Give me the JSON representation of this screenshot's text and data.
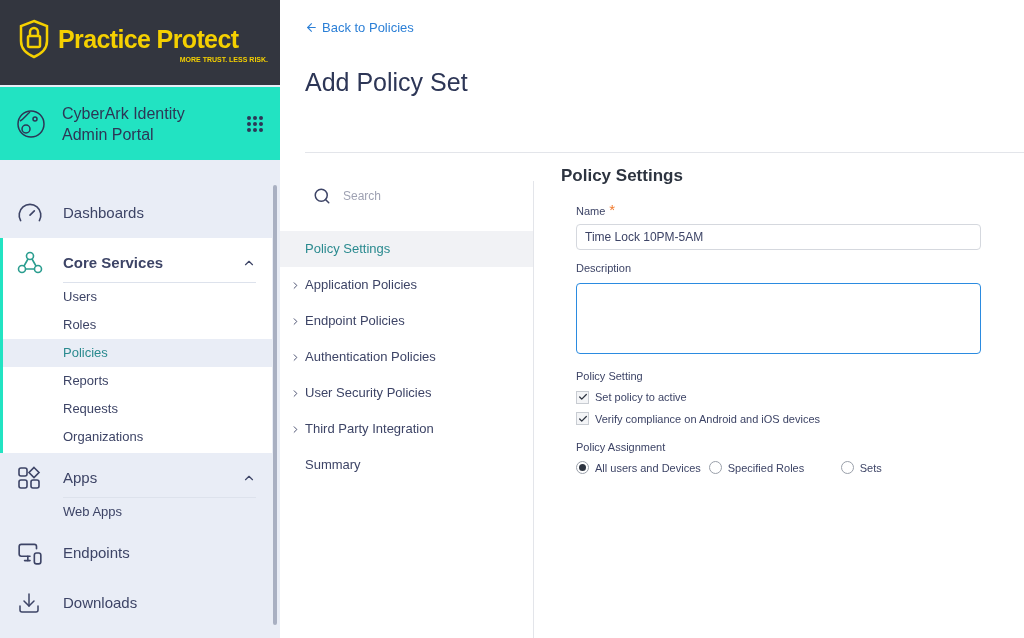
{
  "logo": {
    "name": "Practice Protect",
    "tagline": "MORE TRUST. LESS RISK."
  },
  "portal": {
    "title": "CyberArk Identity Admin Portal"
  },
  "nav": [
    {
      "label": "Dashboards",
      "selected": false,
      "expanded": false
    },
    {
      "label": "Core Services",
      "selected": true,
      "expanded": true,
      "children": [
        {
          "label": "Users",
          "selected": false
        },
        {
          "label": "Roles",
          "selected": false
        },
        {
          "label": "Policies",
          "selected": true
        },
        {
          "label": "Reports",
          "selected": false
        },
        {
          "label": "Requests",
          "selected": false
        },
        {
          "label": "Organizations",
          "selected": false
        }
      ]
    },
    {
      "label": "Apps",
      "selected": false,
      "expanded": true,
      "children": [
        {
          "label": "Web Apps",
          "selected": false
        }
      ]
    },
    {
      "label": "Endpoints",
      "selected": false,
      "expanded": false
    },
    {
      "label": "Downloads",
      "selected": false,
      "expanded": false
    }
  ],
  "back_link": "Back to Policies",
  "page_title": "Add Policy Set",
  "search": {
    "placeholder": "Search"
  },
  "sections": [
    {
      "label": "Policy Settings",
      "kind": "page",
      "selected": true
    },
    {
      "label": "Application Policies",
      "kind": "group",
      "selected": false
    },
    {
      "label": "Endpoint Policies",
      "kind": "group",
      "selected": false
    },
    {
      "label": "Authentication Policies",
      "kind": "group",
      "selected": false
    },
    {
      "label": "User Security Policies",
      "kind": "group",
      "selected": false
    },
    {
      "label": "Third Party Integration",
      "kind": "group",
      "selected": false
    },
    {
      "label": "Summary",
      "kind": "page",
      "selected": false
    }
  ],
  "form": {
    "title": "Policy Settings",
    "name": {
      "label": "Name",
      "required": "*",
      "value": "Time Lock 10PM-5AM"
    },
    "description": {
      "label": "Description",
      "focused": true
    },
    "policy_setting": {
      "label": "Policy Setting",
      "options": [
        {
          "label": "Set policy to active",
          "checked": true
        },
        {
          "label": "Verify compliance on Android and iOS devices",
          "checked": true
        }
      ]
    },
    "policy_assignment": {
      "label": "Policy Assignment",
      "options": [
        {
          "label": "All users and Devices",
          "selected": true
        },
        {
          "label": "Specified Roles",
          "selected": false
        },
        {
          "label": "Sets",
          "selected": false
        }
      ]
    }
  }
}
